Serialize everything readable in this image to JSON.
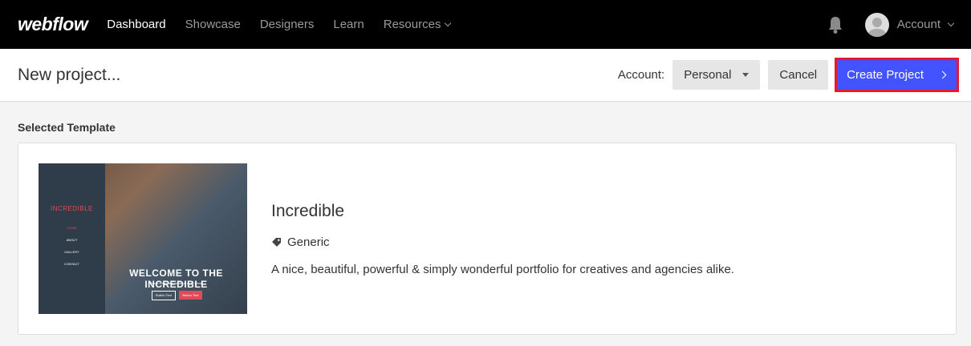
{
  "nav": {
    "logo": "webflow",
    "links": [
      "Dashboard",
      "Showcase",
      "Designers",
      "Learn",
      "Resources"
    ],
    "account": "Account"
  },
  "header": {
    "title": "New project...",
    "account_label": "Account:",
    "account_value": "Personal",
    "cancel_label": "Cancel",
    "create_label": "Create Project"
  },
  "section_label": "Selected Template",
  "template": {
    "name": "Incredible",
    "tag": "Generic",
    "description": "A nice, beautiful, powerful & simply wonderful portfolio for creatives and agencies alike.",
    "thumb": {
      "brand": "INCREDIBLE",
      "menu": [
        "HOME",
        "ABOUT",
        "GALLERY",
        "CONTACT"
      ],
      "headline": "WELCOME TO THE INCREDIBLE",
      "subtext": "This is some text inside of a div block.",
      "btn1": "Button Text",
      "btn2": "Button Text"
    }
  },
  "colors": {
    "accent": "#4353ff",
    "highlight": "#e8192c",
    "nav_bg": "#000000"
  },
  "icons": [
    "bell-icon",
    "avatar-icon",
    "chevron-down-icon",
    "caret-down-icon",
    "chevron-right-icon",
    "tag-icon"
  ]
}
